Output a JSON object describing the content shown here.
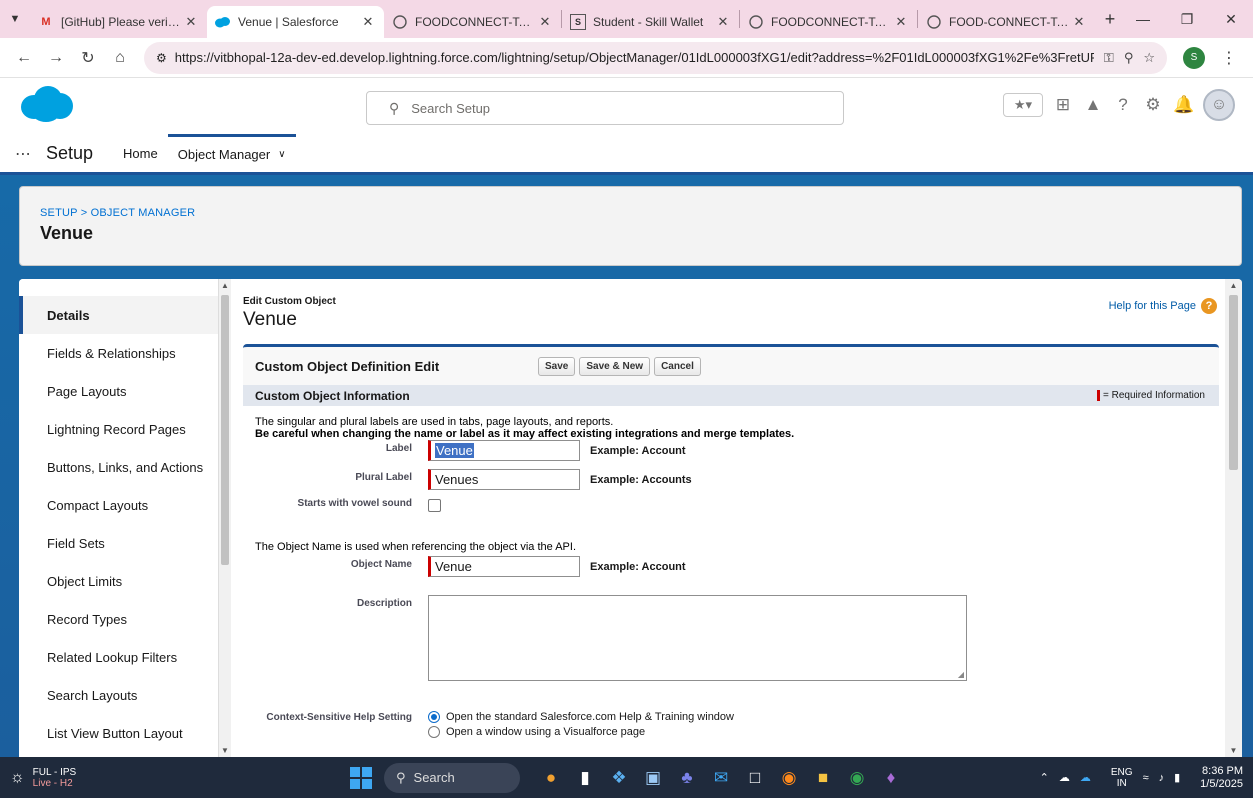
{
  "browser": {
    "tabs": [
      {
        "title": "[GitHub] Please verify your",
        "favicon": "gmail-icon",
        "active": false
      },
      {
        "title": "Venue | Salesforce",
        "favicon": "salesforce-icon",
        "active": true
      },
      {
        "title": "FOODCONNECT-To-Supply",
        "favicon": "github-icon",
        "active": false
      },
      {
        "title": "Student - Skill Wallet",
        "favicon": "skillwallet-icon",
        "active": false
      },
      {
        "title": "FOODCONNECT-To-Supply",
        "favicon": "github-icon",
        "active": false
      },
      {
        "title": "FOOD-CONNECT-To-Supp",
        "favicon": "github-icon",
        "active": false
      }
    ],
    "url": "https://vitbhopal-12a-dev-ed.develop.lightning.force.com/lightning/setup/ObjectManager/01IdL000003fXG1/edit?address=%2F01IdL000003fXG1%2Fe%3FretURL%3D%252Fsetup%252...",
    "profile_initial": "S"
  },
  "header": {
    "search_placeholder": "Search Setup"
  },
  "appnav": {
    "app_name": "Setup",
    "items": [
      {
        "label": "Home"
      },
      {
        "label": "Object Manager"
      }
    ]
  },
  "pagehead": {
    "breadcrumb": "SETUP > OBJECT MANAGER",
    "title": "Venue"
  },
  "sidebar": {
    "items": [
      {
        "label": "Details",
        "active": true
      },
      {
        "label": "Fields & Relationships"
      },
      {
        "label": "Page Layouts"
      },
      {
        "label": "Lightning Record Pages"
      },
      {
        "label": "Buttons, Links, and Actions"
      },
      {
        "label": "Compact Layouts"
      },
      {
        "label": "Field Sets"
      },
      {
        "label": "Object Limits"
      },
      {
        "label": "Record Types"
      },
      {
        "label": "Related Lookup Filters"
      },
      {
        "label": "Search Layouts"
      },
      {
        "label": "List View Button Layout"
      }
    ]
  },
  "content": {
    "subtitle": "Edit Custom Object",
    "title": "Venue",
    "help_link": "Help for this Page",
    "panel_title": "Custom Object Definition Edit",
    "buttons": {
      "save": "Save",
      "save_new": "Save & New",
      "cancel": "Cancel"
    },
    "section_title": "Custom Object Information",
    "required_info": "= Required Information",
    "note1": "The singular and plural labels are used in tabs, page layouts, and reports.",
    "note2": "Be careful when changing the name or label as it may affect existing integrations and merge templates.",
    "label_field": {
      "label": "Label",
      "value": "Venue",
      "example": "Example:  Account"
    },
    "plural_field": {
      "label": "Plural Label",
      "value": "Venues",
      "example": "Example:  Accounts"
    },
    "vowel_field": {
      "label": "Starts with vowel sound",
      "checked": false
    },
    "note3": "The Object Name is used when referencing the object via the API.",
    "name_field": {
      "label": "Object Name",
      "value": "Venue",
      "example": "Example:  Account"
    },
    "description_field": {
      "label": "Description",
      "value": ""
    },
    "help_setting": {
      "label": "Context-Sensitive Help Setting",
      "option1": "Open the standard Salesforce.com Help & Training window",
      "option2": "Open a window using a Visualforce page",
      "selected": 1
    }
  },
  "taskbar": {
    "weather_line1": "FUL - IPS",
    "weather_line2": "Live - H2",
    "search": "Search",
    "lang1": "ENG",
    "lang2": "IN",
    "time": "8:36 PM",
    "date": "1/5/2025"
  }
}
